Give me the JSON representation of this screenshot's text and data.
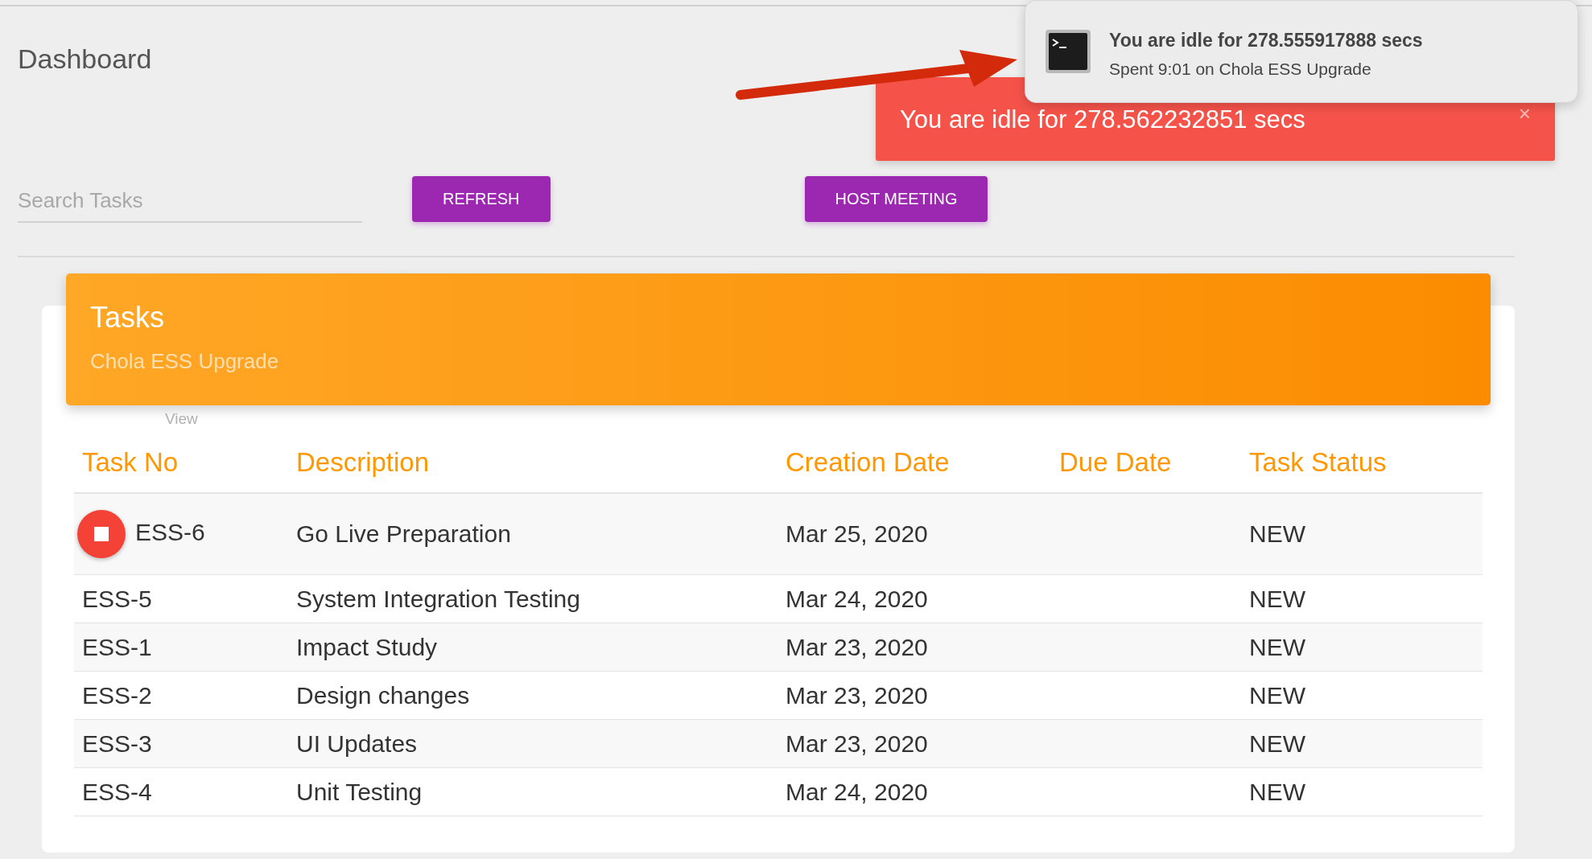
{
  "page": {
    "title": "Dashboard"
  },
  "search": {
    "placeholder": "Search Tasks"
  },
  "buttons": [
    {
      "label": "REFRESH"
    },
    {
      "label": "HOST MEETING"
    }
  ],
  "toast": {
    "message": "You are idle for 278.562232851 secs",
    "close": "×"
  },
  "notification": {
    "title": "You are idle for 278.555917888 secs",
    "body": "Spent 9:01 on Chola ESS Upgrade"
  },
  "card": {
    "title": "Tasks",
    "subtitle": "Chola ESS Upgrade",
    "view_label": "View"
  },
  "table": {
    "columns": [
      "Task No",
      "Description",
      "Creation Date",
      "Due Date",
      "Task Status"
    ],
    "rows": [
      {
        "task_no": "ESS-6",
        "description": "Go Live Preparation",
        "creation_date": "Mar 25, 2020",
        "status": "NEW",
        "running": true
      },
      {
        "task_no": "ESS-5",
        "description": "System Integration Testing",
        "creation_date": "Mar 24, 2020",
        "status": "NEW",
        "running": false
      },
      {
        "task_no": "ESS-1",
        "description": "Impact Study",
        "creation_date": "Mar 23, 2020",
        "status": "NEW",
        "running": false
      },
      {
        "task_no": "ESS-2",
        "description": "Design changes",
        "creation_date": "Mar 23, 2020",
        "status": "NEW",
        "running": false
      },
      {
        "task_no": "ESS-3",
        "description": "UI Updates",
        "creation_date": "Mar 23, 2020",
        "status": "NEW",
        "running": false
      },
      {
        "task_no": "ESS-4",
        "description": "Unit Testing",
        "creation_date": "Mar 24, 2020",
        "status": "NEW",
        "running": false
      }
    ]
  }
}
